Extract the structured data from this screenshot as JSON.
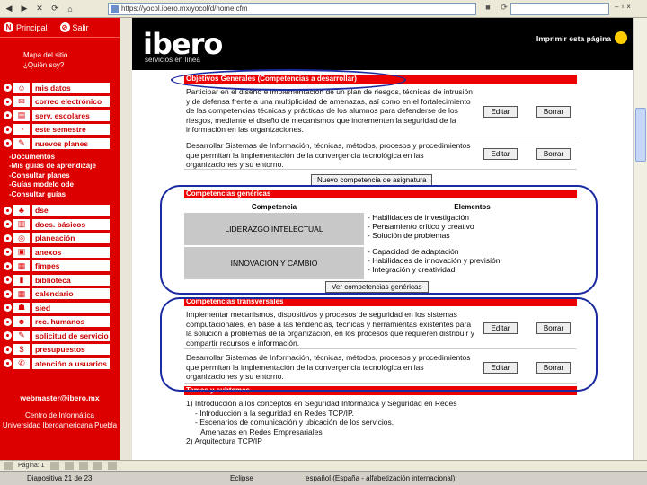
{
  "browser": {
    "address": "https://yocol.ibero.mx/yocol/d/home.cfm",
    "nav_glyphs": [
      "◀",
      "▶",
      "✕",
      "⟳",
      "⌂"
    ]
  },
  "sidebar": {
    "principal_label": "Principal",
    "salir_label": "Salir",
    "user_lines": [
      "Mapa del sitio",
      "¿Quién soy?"
    ],
    "items": [
      {
        "label": "mis datos",
        "icon": "person-icon",
        "glyph": "☺"
      },
      {
        "label": "correo electrónico",
        "icon": "mail-icon",
        "glyph": "✉"
      },
      {
        "label": "serv. escolares",
        "icon": "school-icon",
        "glyph": "▤"
      },
      {
        "label": "este semestre",
        "icon": "calendar-icon",
        "glyph": "◔"
      },
      {
        "label": "nuevos planes",
        "icon": "plan-icon",
        "glyph": "✎"
      }
    ],
    "sub_items": [
      "-Documentos",
      "-Mis guías de aprendizaje",
      "-Consultar planes",
      "-Guías modelo ode",
      "-Consultar guías"
    ],
    "items2": [
      {
        "label": "dse",
        "icon": "dse-icon",
        "glyph": "♣"
      },
      {
        "label": "docs. básicos",
        "icon": "book-icon",
        "glyph": "▥"
      },
      {
        "label": "planeación",
        "icon": "planning-icon",
        "glyph": "◎"
      },
      {
        "label": "anexos",
        "icon": "attachment-icon",
        "glyph": "▣"
      },
      {
        "label": "fimpes",
        "icon": "fimpes-icon",
        "glyph": "▦"
      },
      {
        "label": "biblioteca",
        "icon": "library-icon",
        "glyph": "▮"
      },
      {
        "label": "calendario",
        "icon": "calendar2-icon",
        "glyph": "▦"
      },
      {
        "label": "sied",
        "icon": "sied-icon",
        "glyph": "☗"
      },
      {
        "label": "rec. humanos",
        "icon": "people-icon",
        "glyph": "☻"
      },
      {
        "label": "solicitud de servicio",
        "icon": "service-icon",
        "glyph": "✎"
      },
      {
        "label": "presupuestos",
        "icon": "budget-icon",
        "glyph": "$"
      },
      {
        "label": "atención a usuarios",
        "icon": "support-icon",
        "glyph": "✆"
      }
    ],
    "footer_mail": "webmaster@ibero.mx",
    "footer_lines": [
      "Centro de Informática",
      "Universidad Iberoamericana Puebla"
    ]
  },
  "header": {
    "logo": "ibero",
    "logo_sub": "servicios en línea",
    "print_label": "Imprimir esta página"
  },
  "objetivos": {
    "title": "Objetivos Generales (Competencias a desarrollar)",
    "rows": [
      {
        "text": "Participar en el diseño e implementación de un plan de riesgos, técnicas de intrusión y de defensa frente a una multiplicidad de amenazas, así como en el fortalecimiento de las competencias técnicas y prácticas de los alumnos para defenderse de los riesgos, mediante el diseño de mecanismos que incrementen la seguridad de la información en las organizaciones."
      },
      {
        "text": "Desarrollar Sistemas de Información, técnicas, métodos, procesos y procedimientos que permitan la implementación de la convergencia tecnológica en las organizaciones y su entorno."
      }
    ],
    "new_button": "Nuevo competencia de asignatura"
  },
  "genericas": {
    "title": "Competencias genéricas",
    "col_competencia": "Competencia",
    "col_elementos": "Elementos",
    "rows": [
      {
        "name": "LIDERAZGO INTELECTUAL",
        "elements": [
          "- Habilidades de investigación",
          "- Pensamiento crítico y creativo",
          "- Solución de problemas"
        ]
      },
      {
        "name": "INNOVACIÓN Y CAMBIO",
        "elements": [
          "- Capacidad de adaptación",
          "- Habilidades de innovación y previsión",
          "- Integración y creatividad"
        ]
      }
    ],
    "view_button": "Ver competencias genéricas"
  },
  "transversales": {
    "title": "Competencias transversales",
    "rows": [
      {
        "text": "Implementar mecanismos, dispositivos y procesos de seguridad en los sistemas computacionales, en base a las tendencias, técnicas y herramientas existentes para la solución a problemas de la organización, en los procesos que requieren distribuir y compartir recursos e información."
      },
      {
        "text": "Desarrollar Sistemas de Información, técnicas, métodos, procesos y procedimientos que permitan la implementación de la convergencia tecnológica en las organizaciones y su entorno."
      }
    ]
  },
  "temas": {
    "title": "Temas y subtemas",
    "lines": [
      "1) Introducción a los conceptos en Seguridad Informática y Seguridad en Redes",
      "- Introducción a la seguridad en Redes TCP/IP.",
      "- Escenarios de comunicación y ubicación de los servicios.",
      "  Amenazas en Redes Empresariales",
      "2) Arquitectura TCP/IP"
    ]
  },
  "buttons": {
    "edit": "Editar",
    "delete": "Borrar"
  },
  "taskbar": {
    "page": "Página: 1"
  },
  "status": {
    "slide": "Diapositiva 21 de 23",
    "theme": "Eclipse",
    "lang": "español (España - alfabetización internacional)"
  },
  "colors": {
    "brand_red": "#dd0000",
    "annotation_blue": "#1a2aa0",
    "header_black": "#000000"
  }
}
